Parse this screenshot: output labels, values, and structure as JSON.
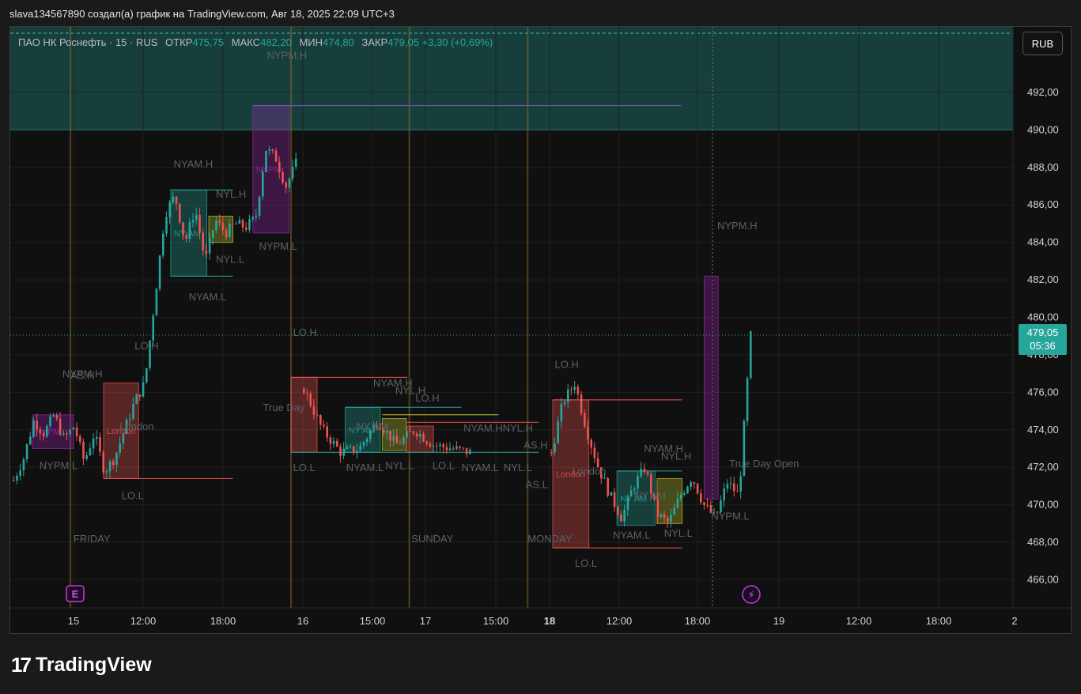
{
  "header": {
    "attribution": "slava134567890 создал(а) график на TradingView.com, Авг 18, 2025 22:09 UTC+3"
  },
  "legend": {
    "symbol": "ПАО НК Роснефть · 15 · RUS",
    "open_label": "ОТКР",
    "open": "475,75",
    "high_label": "МАКС",
    "high": "482,20",
    "low_label": "МИН",
    "low": "474,80",
    "close_label": "ЗАКР",
    "close": "479,05",
    "change": "+3,30 (+0,69%)"
  },
  "currency_button": "RUB",
  "price_tag": {
    "price": "479,05",
    "countdown": "05:36"
  },
  "brand": {
    "name": "TradingView"
  },
  "icons": {
    "earnings": "E",
    "dividend": "⚡"
  },
  "colors": {
    "up": "#26a69a",
    "down": "#ef5350",
    "background": "#101010",
    "session_line": "#8b6a2d"
  },
  "chart_data": {
    "type": "candlestick",
    "ylim": [
      464.5,
      495.5
    ],
    "y_ticks": [
      466,
      468,
      470,
      472,
      474,
      476,
      478,
      480,
      482,
      484,
      486,
      488,
      490,
      492
    ],
    "y_tick_labels": [
      "466,00",
      "468,00",
      "470,00",
      "472,00",
      "474,00",
      "476,00",
      "478,00",
      "480,00",
      "482,00",
      "484,00",
      "486,00",
      "488,00",
      "490,00",
      "492,00"
    ],
    "x_tick_labels": [
      {
        "label": "15",
        "i": 0,
        "bold": false
      },
      {
        "label": "12:00",
        "i": 1,
        "bold": false
      },
      {
        "label": "18:00",
        "i": 2,
        "bold": false
      },
      {
        "label": "16",
        "i": 3,
        "bold": false
      },
      {
        "label": "15:00",
        "i": 4,
        "bold": false
      },
      {
        "label": "17",
        "i": 5,
        "bold": false
      },
      {
        "label": "15:00",
        "i": 6,
        "bold": false
      },
      {
        "label": "18",
        "i": 7,
        "bold": true
      },
      {
        "label": "12:00",
        "i": 8,
        "bold": false
      },
      {
        "label": "18:00",
        "i": 9,
        "bold": false
      },
      {
        "label": "19",
        "i": 10,
        "bold": false
      },
      {
        "label": "12:00",
        "i": 11,
        "bold": false
      },
      {
        "label": "18:00",
        "i": 12,
        "bold": false
      },
      {
        "label": "2",
        "i": 13,
        "bold": false
      }
    ],
    "horizontal_level": 490.0,
    "premium_zone": [
      490.0,
      495.5
    ],
    "last_price": 479.05,
    "segments": [
      {
        "session": "FRIDAY",
        "path": [
          [
            471.3,
            1
          ],
          [
            472.5,
            2
          ],
          [
            474.5,
            3
          ],
          [
            473.8,
            4
          ],
          [
            474.8,
            3
          ],
          [
            473.5,
            5
          ],
          [
            474.2,
            4
          ],
          [
            472.3,
            3
          ],
          [
            473.8,
            6
          ],
          [
            471.8,
            5
          ],
          [
            472.5,
            4
          ],
          [
            474.0,
            8
          ],
          [
            475.5,
            9
          ],
          [
            476.5,
            10
          ],
          [
            481.0,
            11
          ],
          [
            485.5,
            12
          ],
          [
            486.5,
            13
          ],
          [
            484.0,
            14
          ],
          [
            485.8,
            15
          ],
          [
            483.0,
            16
          ],
          [
            485.2,
            17
          ],
          [
            484.5,
            18
          ],
          [
            485.0,
            19
          ],
          [
            484.8,
            20
          ],
          [
            485.3,
            21
          ],
          [
            489.0,
            22
          ],
          [
            488.5,
            23
          ],
          [
            487.0,
            24
          ],
          [
            488.2,
            25
          ]
        ]
      },
      {
        "session": "SUNDAY",
        "path": [
          [
            476.2,
            1
          ],
          [
            474.0,
            2
          ],
          [
            472.8,
            3
          ],
          [
            473.0,
            4
          ],
          [
            474.5,
            5
          ],
          [
            473.2,
            6
          ],
          [
            474.0,
            7
          ],
          [
            473.2,
            8
          ],
          [
            473.0,
            9
          ],
          [
            472.8,
            10
          ]
        ]
      },
      {
        "session": "MONDAY",
        "path": [
          [
            472.8,
            1
          ],
          [
            475.5,
            2
          ],
          [
            476.5,
            3
          ],
          [
            474.0,
            4
          ],
          [
            472.0,
            5
          ],
          [
            470.5,
            6
          ],
          [
            469.3,
            7
          ],
          [
            471.0,
            8
          ],
          [
            472.0,
            9
          ],
          [
            469.5,
            10
          ],
          [
            469.0,
            11
          ],
          [
            470.5,
            12
          ],
          [
            471.5,
            13
          ],
          [
            470.0,
            14
          ],
          [
            469.3,
            15
          ],
          [
            471.2,
            16
          ],
          [
            470.5,
            17
          ],
          [
            479.0,
            18
          ]
        ]
      }
    ],
    "boxes": [
      {
        "x0": 0.022,
        "x1": 0.063,
        "y0": 473.0,
        "y1": 474.8,
        "color": "#9c27b0",
        "label": "NYPM"
      },
      {
        "x0": 0.093,
        "x1": 0.128,
        "y0": 471.4,
        "y1": 476.5,
        "color": "#ef5350",
        "label": "London"
      },
      {
        "x0": 0.16,
        "x1": 0.196,
        "y0": 482.2,
        "y1": 486.8,
        "color": "#26a69a",
        "label": "NY AM"
      },
      {
        "x0": 0.198,
        "x1": 0.222,
        "y0": 484.0,
        "y1": 485.4,
        "color": "#c0ca33",
        "label": ""
      },
      {
        "x0": 0.242,
        "x1": 0.278,
        "y0": 484.5,
        "y1": 491.3,
        "color": "#9c27b0",
        "label": "NYPM"
      },
      {
        "x0": 0.28,
        "x1": 0.306,
        "y0": 472.8,
        "y1": 476.8,
        "color": "#ef5350",
        "label": ""
      },
      {
        "x0": 0.334,
        "x1": 0.369,
        "y0": 472.8,
        "y1": 475.2,
        "color": "#26a69a",
        "label": "NY AM"
      },
      {
        "x0": 0.371,
        "x1": 0.395,
        "y0": 472.9,
        "y1": 474.6,
        "color": "#c0ca33",
        "label": ""
      },
      {
        "x0": 0.395,
        "x1": 0.422,
        "y0": 472.8,
        "y1": 474.2,
        "color": "#ef5350",
        "label": ""
      },
      {
        "x0": 0.541,
        "x1": 0.577,
        "y0": 467.7,
        "y1": 475.6,
        "color": "#ef5350",
        "label": "London"
      },
      {
        "x0": 0.605,
        "x1": 0.643,
        "y0": 468.9,
        "y1": 471.8,
        "color": "#26a69a",
        "label": "NY AM"
      },
      {
        "x0": 0.645,
        "x1": 0.67,
        "y0": 469.0,
        "y1": 471.4,
        "color": "#c0ca33",
        "label": ""
      },
      {
        "x0": 0.692,
        "x1": 0.706,
        "y0": 470.3,
        "y1": 482.2,
        "color": "#9c27b0",
        "label": ""
      }
    ],
    "levels": [
      {
        "x0": 0.242,
        "x1": 0.669,
        "y": 491.3,
        "color": "#7e57c2"
      },
      {
        "x0": 0.16,
        "x1": 0.222,
        "y": 486.8,
        "color": "#26a69a"
      },
      {
        "x0": 0.16,
        "x1": 0.222,
        "y": 482.2,
        "color": "#26a69a"
      },
      {
        "x0": 0.093,
        "x1": 0.222,
        "y": 471.4,
        "color": "#ef5350"
      },
      {
        "x0": 0.28,
        "x1": 0.396,
        "y": 476.8,
        "color": "#ef5350"
      },
      {
        "x0": 0.334,
        "x1": 0.45,
        "y": 475.2,
        "color": "#26a69a"
      },
      {
        "x0": 0.371,
        "x1": 0.487,
        "y": 474.8,
        "color": "#c0ca33"
      },
      {
        "x0": 0.395,
        "x1": 0.527,
        "y": 474.4,
        "color": "#ef5350"
      },
      {
        "x0": 0.28,
        "x1": 0.527,
        "y": 472.8,
        "color": "#26a69a"
      },
      {
        "x0": 0.541,
        "x1": 0.67,
        "y": 475.6,
        "color": "#ef5350"
      },
      {
        "x0": 0.541,
        "x1": 0.67,
        "y": 467.7,
        "color": "#ef5350"
      },
      {
        "x0": 0.605,
        "x1": 0.67,
        "y": 471.8,
        "color": "#26a69a"
      }
    ],
    "session_lines": [
      0.06,
      0.28,
      0.398,
      0.516
    ],
    "annotations": [
      {
        "text": "NYPM.H",
        "x": 0.256,
        "y": 493.8
      },
      {
        "text": "NYAM.H",
        "x": 0.163,
        "y": 488.0
      },
      {
        "text": "NYL.H",
        "x": 0.205,
        "y": 486.4
      },
      {
        "text": "NYL.L",
        "x": 0.205,
        "y": 482.9
      },
      {
        "text": "NYPM.L",
        "x": 0.248,
        "y": 483.6
      },
      {
        "text": "NYAM.L",
        "x": 0.178,
        "y": 480.9
      },
      {
        "text": "NYPM.H",
        "x": 0.052,
        "y": 476.8
      },
      {
        "text": "AS.H",
        "x": 0.06,
        "y": 476.7
      },
      {
        "text": "LO.H",
        "x": 0.124,
        "y": 478.3
      },
      {
        "text": "London",
        "x": 0.109,
        "y": 474.0
      },
      {
        "text": "NYPM.L",
        "x": 0.029,
        "y": 471.9
      },
      {
        "text": "LO.L",
        "x": 0.111,
        "y": 470.3
      },
      {
        "text": "FRIDAY",
        "x": 0.063,
        "y": 468.0
      },
      {
        "text": "LO.H",
        "x": 0.282,
        "y": 479.0
      },
      {
        "text": "True Day",
        "x": 0.252,
        "y": 475.0
      },
      {
        "text": "NYAM.H",
        "x": 0.362,
        "y": 476.3
      },
      {
        "text": "NYL.H",
        "x": 0.384,
        "y": 475.9
      },
      {
        "text": "LO.H",
        "x": 0.404,
        "y": 475.5
      },
      {
        "text": "NY AM",
        "x": 0.345,
        "y": 474.0
      },
      {
        "text": "NYAM.H",
        "x": 0.452,
        "y": 473.9
      },
      {
        "text": "NYL.H",
        "x": 0.491,
        "y": 473.9
      },
      {
        "text": "AS.H",
        "x": 0.512,
        "y": 473.0
      },
      {
        "text": "LO.L",
        "x": 0.282,
        "y": 471.8
      },
      {
        "text": "NYAM.L",
        "x": 0.335,
        "y": 471.8
      },
      {
        "text": "NYL.L",
        "x": 0.374,
        "y": 471.9
      },
      {
        "text": "LO.L",
        "x": 0.421,
        "y": 471.9
      },
      {
        "text": "NYAM.L",
        "x": 0.45,
        "y": 471.8
      },
      {
        "text": "NYL.L",
        "x": 0.492,
        "y": 471.8
      },
      {
        "text": "AS.L",
        "x": 0.514,
        "y": 470.9
      },
      {
        "text": "SUNDAY",
        "x": 0.4,
        "y": 468.0
      },
      {
        "text": "LO.H",
        "x": 0.543,
        "y": 477.3
      },
      {
        "text": "London",
        "x": 0.56,
        "y": 471.6
      },
      {
        "text": "MONDAY",
        "x": 0.516,
        "y": 468.0
      },
      {
        "text": "LO.L",
        "x": 0.563,
        "y": 466.7
      },
      {
        "text": "NYAM.H",
        "x": 0.632,
        "y": 472.8
      },
      {
        "text": "NYL.H",
        "x": 0.649,
        "y": 472.4
      },
      {
        "text": "NY AM",
        "x": 0.622,
        "y": 470.3
      },
      {
        "text": "NYAM.L",
        "x": 0.601,
        "y": 468.2
      },
      {
        "text": "NYL.L",
        "x": 0.652,
        "y": 468.3
      },
      {
        "text": "True Day Open",
        "x": 0.717,
        "y": 472.0
      },
      {
        "text": "NYPM.L",
        "x": 0.699,
        "y": 469.2
      },
      {
        "text": "NYPM.H",
        "x": 0.705,
        "y": 484.7
      }
    ]
  }
}
